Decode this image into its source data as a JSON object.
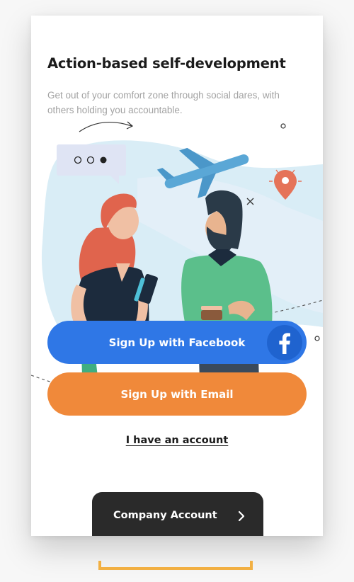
{
  "onboarding": {
    "title": "Action-based self-development",
    "subtitle": "Get out of your comfort zone through social dares, with others holding you accountable."
  },
  "buttons": {
    "facebook_label": "Sign Up with Facebook",
    "email_label": "Sign Up with Email",
    "login_link": "I have an account",
    "company_label": "Company Account"
  },
  "icons": {
    "facebook": "facebook-logo-icon",
    "company_arrow": "chevron-right-icon",
    "location": "location-pin-icon",
    "airplane": "airplane-icon",
    "chat": "chat-bubble-icon"
  },
  "colors": {
    "facebook_blue": "#2f77e6",
    "email_orange": "#f0893a",
    "company_dark": "#2a2a2a",
    "accent_yellow": "#f2b043"
  }
}
